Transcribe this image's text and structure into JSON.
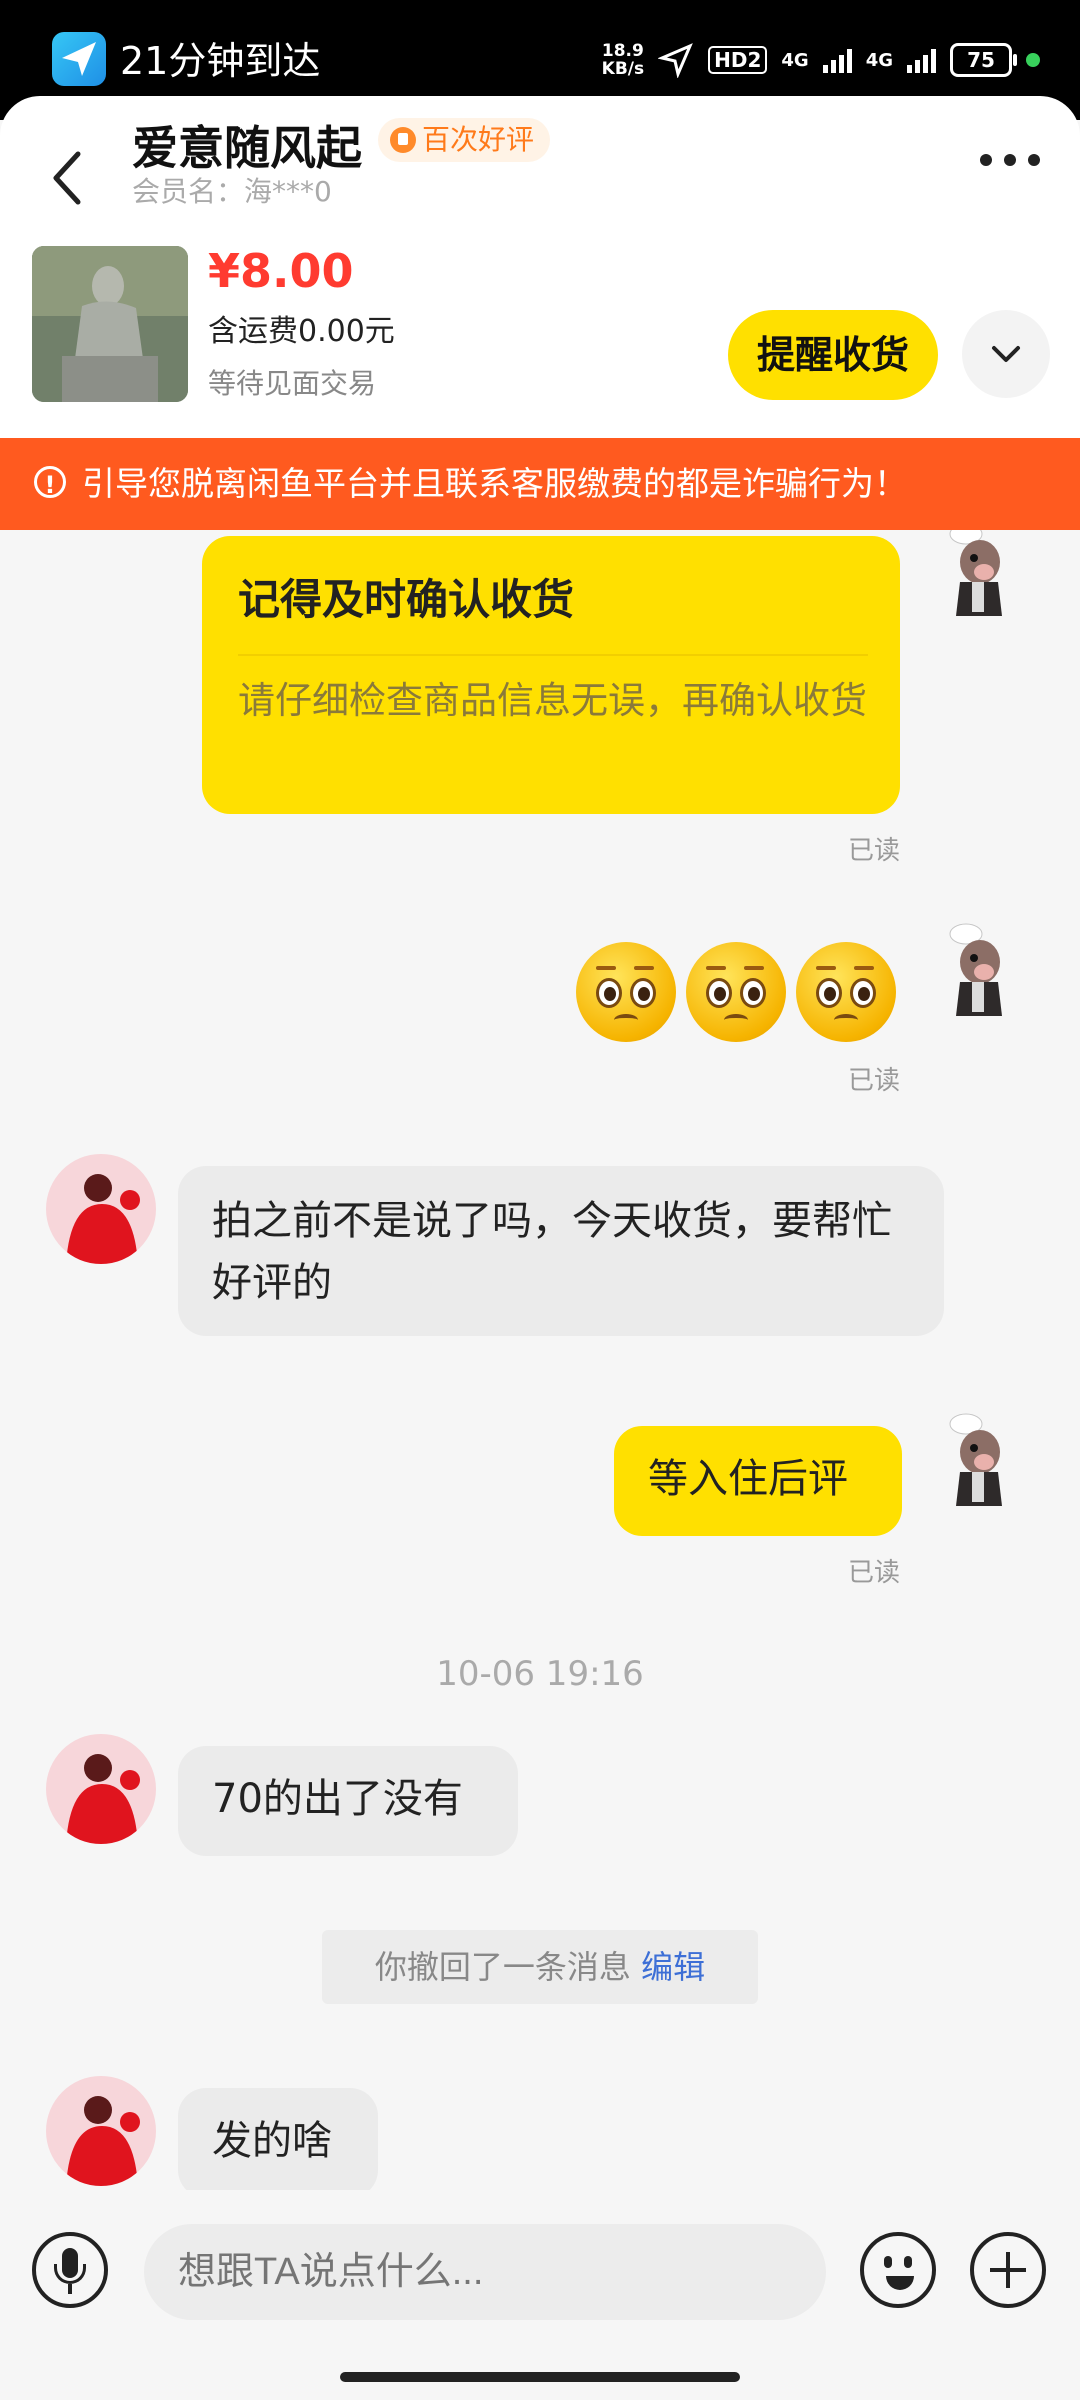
{
  "status_bar": {
    "app_name": "21分钟到达",
    "speed_top": "18.9",
    "speed_bottom": "KB/s",
    "hd": "HD2",
    "net1": "4G",
    "net2": "4G",
    "battery": "75"
  },
  "header": {
    "seller_name": "爱意随风起",
    "badge": "百次好评",
    "member": "会员名：海***0",
    "price": "¥8.00",
    "shipping": "含运费0.00元",
    "trade_status": "等待见面交易",
    "remind_button": "提醒收货"
  },
  "warning": "引导您脱离闲鱼平台并且联系客服缴费的都是诈骗行为！",
  "chat": {
    "card_title": "记得及时确认收货",
    "card_body": "请仔细检查商品信息无误，再确认收货",
    "read_label": "已读",
    "msg1": "拍之前不是说了吗，今天收货，要帮忙好评的",
    "msg2": "等入住后评",
    "timestamp": "10-06 19:16",
    "msg3": "70的出了没有",
    "recall_text": "你撤回了一条消息",
    "recall_edit": "编辑",
    "msg4": "发的啥"
  },
  "input": {
    "placeholder": "想跟TA说点什么..."
  },
  "colors": {
    "accent": "#ffe000",
    "warning": "#ff5a1f",
    "price": "#ff3b30"
  },
  "icons": [
    "back-icon",
    "more-icon",
    "chevron-down-icon",
    "mic-icon",
    "emoji-icon",
    "plus-icon",
    "alert-icon"
  ]
}
